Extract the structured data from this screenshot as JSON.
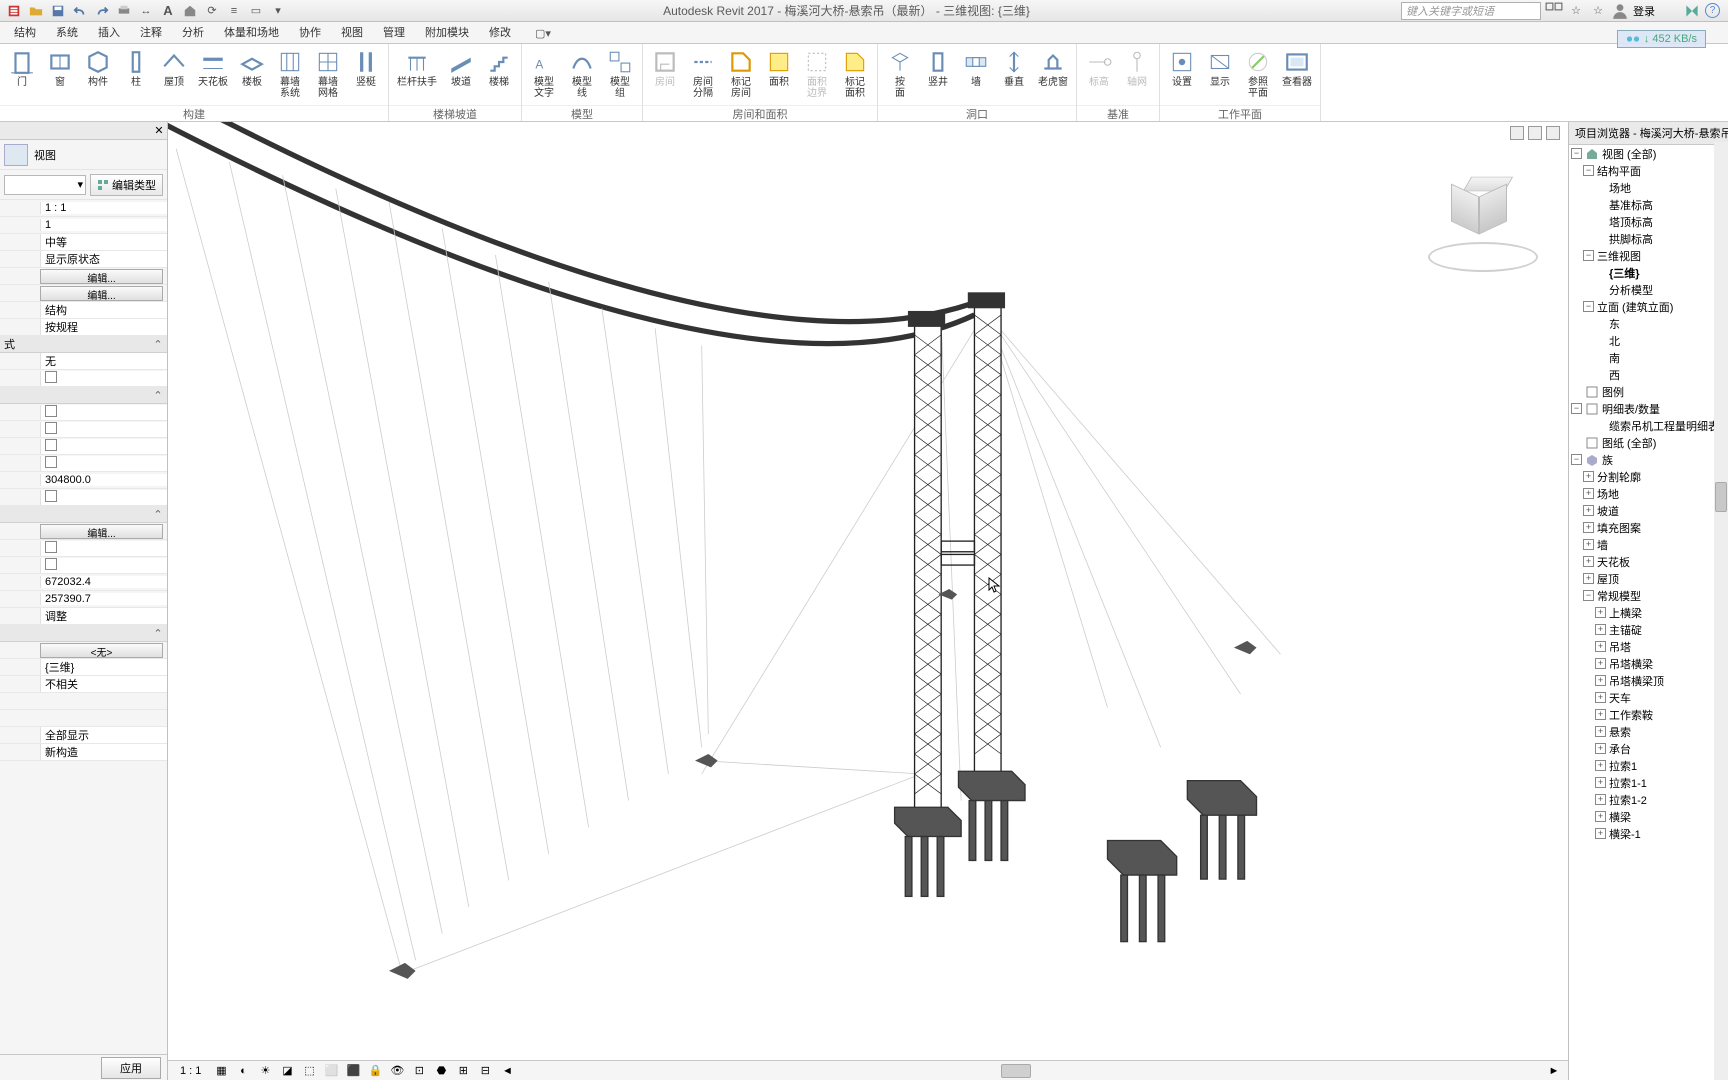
{
  "app": {
    "title": "Autodesk Revit 2017 -    梅溪河大桥-悬索吊（最新） - 三维视图: {三维}",
    "search_placeholder": "键入关键字或短语",
    "login": "登录"
  },
  "overlay": {
    "speed": "↓ 452 KB/s"
  },
  "tabs": [
    "结构",
    "系统",
    "插入",
    "注释",
    "分析",
    "体量和场地",
    "协作",
    "视图",
    "管理",
    "附加模块",
    "修改"
  ],
  "ribbon": {
    "groups": [
      {
        "label": "构建",
        "tools": [
          {
            "name": "door",
            "label": "门"
          },
          {
            "name": "window",
            "label": "窗"
          },
          {
            "name": "component",
            "label": "构件"
          },
          {
            "name": "column",
            "label": "柱"
          },
          {
            "name": "roof",
            "label": "屋顶"
          },
          {
            "name": "ceiling",
            "label": "天花板"
          },
          {
            "name": "floor",
            "label": "楼板"
          },
          {
            "name": "curtain-system",
            "label": "幕墙\n系统"
          },
          {
            "name": "curtain-grid",
            "label": "幕墙\n网格"
          },
          {
            "name": "mullion",
            "label": "竖梃"
          }
        ]
      },
      {
        "label": "楼梯坡道",
        "tools": [
          {
            "name": "railing",
            "label": "栏杆扶手"
          },
          {
            "name": "ramp",
            "label": "坡道"
          },
          {
            "name": "stair",
            "label": "楼梯"
          }
        ]
      },
      {
        "label": "模型",
        "tools": [
          {
            "name": "model-text",
            "label": "模型\n文字"
          },
          {
            "name": "model-line",
            "label": "模型\n线"
          },
          {
            "name": "model-group",
            "label": "模型\n组"
          }
        ]
      },
      {
        "label": "房间和面积",
        "tools": [
          {
            "name": "room",
            "label": "房间",
            "disabled": true
          },
          {
            "name": "room-sep",
            "label": "房间\n分隔"
          },
          {
            "name": "tag-room",
            "label": "标记\n房间"
          },
          {
            "name": "area",
            "label": "面积"
          },
          {
            "name": "area-bound",
            "label": "面积\n边界",
            "disabled": true
          },
          {
            "name": "tag-area",
            "label": "标记\n面积"
          }
        ]
      },
      {
        "label": "洞口",
        "tools": [
          {
            "name": "by-face",
            "label": "按\n面"
          },
          {
            "name": "shaft",
            "label": "竖井"
          },
          {
            "name": "wall-open",
            "label": "墙"
          },
          {
            "name": "vertical",
            "label": "垂直"
          },
          {
            "name": "dormer",
            "label": "老虎窗"
          }
        ]
      },
      {
        "label": "基准",
        "tools": [
          {
            "name": "level",
            "label": "标高",
            "disabled": true
          },
          {
            "name": "grid",
            "label": "轴网",
            "disabled": true
          }
        ]
      },
      {
        "label": "工作平面",
        "tools": [
          {
            "name": "set",
            "label": "设置"
          },
          {
            "name": "show",
            "label": "显示"
          },
          {
            "name": "ref-plane",
            "label": "参照\n平面"
          },
          {
            "name": "viewer",
            "label": "查看器"
          }
        ]
      }
    ]
  },
  "properties": {
    "view_label": "视图",
    "edit_type": "编辑类型",
    "rows": [
      {
        "type": "val",
        "v": "1 : 1"
      },
      {
        "type": "val",
        "v": "1"
      },
      {
        "type": "val",
        "v": "中等"
      },
      {
        "type": "val",
        "v": "显示原状态"
      },
      {
        "type": "btn",
        "v": "编辑..."
      },
      {
        "type": "btn",
        "v": "编辑..."
      },
      {
        "type": "val",
        "v": "结构"
      },
      {
        "type": "val",
        "v": "按规程"
      },
      {
        "type": "head",
        "v": "式"
      },
      {
        "type": "val",
        "v": "无"
      },
      {
        "type": "chk"
      },
      {
        "type": "head",
        "v": ""
      },
      {
        "type": "chk"
      },
      {
        "type": "chk"
      },
      {
        "type": "chk"
      },
      {
        "type": "chk"
      },
      {
        "type": "val",
        "v": "304800.0"
      },
      {
        "type": "chk"
      },
      {
        "type": "head",
        "v": ""
      },
      {
        "type": "btn",
        "v": "编辑..."
      },
      {
        "type": "chk"
      },
      {
        "type": "chk"
      },
      {
        "type": "val",
        "v": "672032.4"
      },
      {
        "type": "val",
        "v": "257390.7"
      },
      {
        "type": "val",
        "v": "调整"
      },
      {
        "type": "head",
        "v": ""
      },
      {
        "type": "btn",
        "v": "<无>"
      },
      {
        "type": "val",
        "v": "{三维}"
      },
      {
        "type": "val",
        "v": "不相关"
      },
      {
        "type": "val",
        "v": ""
      },
      {
        "type": "val",
        "v": ""
      },
      {
        "type": "val",
        "v": "全部显示"
      },
      {
        "type": "val",
        "v": "新构造"
      }
    ],
    "apply": "应用"
  },
  "browser": {
    "title": "项目浏览器 - 梅溪河大桥-悬索吊（最新",
    "nodes": [
      {
        "indent": 0,
        "toggle": "-",
        "icon": "house",
        "label": "视图 (全部)"
      },
      {
        "indent": 1,
        "toggle": "-",
        "label": "结构平面"
      },
      {
        "indent": 2,
        "label": "场地"
      },
      {
        "indent": 2,
        "label": "基准标高"
      },
      {
        "indent": 2,
        "label": "塔顶标高"
      },
      {
        "indent": 2,
        "label": "拱脚标高"
      },
      {
        "indent": 1,
        "toggle": "-",
        "label": "三维视图"
      },
      {
        "indent": 2,
        "label": "{三维}",
        "bold": true
      },
      {
        "indent": 2,
        "label": "分析模型"
      },
      {
        "indent": 1,
        "toggle": "-",
        "label": "立面 (建筑立面)"
      },
      {
        "indent": 2,
        "label": "东"
      },
      {
        "indent": 2,
        "label": "北"
      },
      {
        "indent": 2,
        "label": "南"
      },
      {
        "indent": 2,
        "label": "西"
      },
      {
        "indent": 0,
        "icon": "sheet",
        "label": "图例"
      },
      {
        "indent": 0,
        "toggle": "-",
        "icon": "sheet",
        "label": "明细表/数量"
      },
      {
        "indent": 2,
        "label": "缆索吊机工程量明细表"
      },
      {
        "indent": 0,
        "icon": "sheet",
        "label": "图纸 (全部)"
      },
      {
        "indent": 0,
        "toggle": "-",
        "icon": "cube",
        "label": "族"
      },
      {
        "indent": 1,
        "toggle": "+",
        "label": "分割轮廓"
      },
      {
        "indent": 1,
        "toggle": "+",
        "label": "场地"
      },
      {
        "indent": 1,
        "toggle": "+",
        "label": "坡道"
      },
      {
        "indent": 1,
        "toggle": "+",
        "label": "填充图案"
      },
      {
        "indent": 1,
        "toggle": "+",
        "label": "墙"
      },
      {
        "indent": 1,
        "toggle": "+",
        "label": "天花板"
      },
      {
        "indent": 1,
        "toggle": "+",
        "label": "屋顶"
      },
      {
        "indent": 1,
        "toggle": "-",
        "label": "常规模型"
      },
      {
        "indent": 2,
        "toggle": "+",
        "label": "上横梁"
      },
      {
        "indent": 2,
        "toggle": "+",
        "label": "主锚碇"
      },
      {
        "indent": 2,
        "toggle": "+",
        "label": "吊塔"
      },
      {
        "indent": 2,
        "toggle": "+",
        "label": "吊塔横梁"
      },
      {
        "indent": 2,
        "toggle": "+",
        "label": "吊塔横梁顶"
      },
      {
        "indent": 2,
        "toggle": "+",
        "label": "天车"
      },
      {
        "indent": 2,
        "toggle": "+",
        "label": "工作索鞍"
      },
      {
        "indent": 2,
        "toggle": "+",
        "label": "悬索"
      },
      {
        "indent": 2,
        "toggle": "+",
        "label": "承台"
      },
      {
        "indent": 2,
        "toggle": "+",
        "label": "拉索1"
      },
      {
        "indent": 2,
        "toggle": "+",
        "label": "拉索1-1"
      },
      {
        "indent": 2,
        "toggle": "+",
        "label": "拉索1-2"
      },
      {
        "indent": 2,
        "toggle": "+",
        "label": "横梁"
      },
      {
        "indent": 2,
        "toggle": "+",
        "label": "横梁-1"
      }
    ]
  },
  "status": {
    "scale": "1 : 1"
  }
}
